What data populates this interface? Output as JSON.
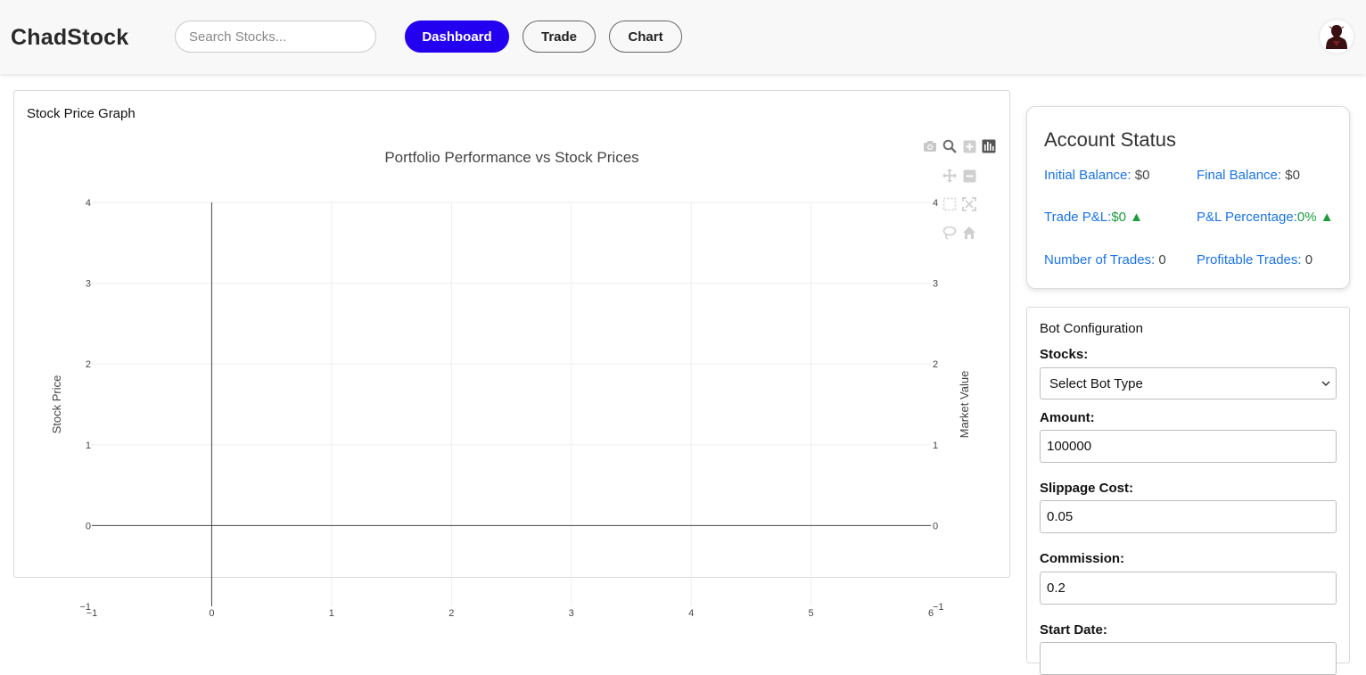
{
  "header": {
    "brand": "ChadStock",
    "search_placeholder": "Search Stocks...",
    "nav": [
      {
        "label": "Dashboard",
        "active": true
      },
      {
        "label": "Trade",
        "active": false
      },
      {
        "label": "Chart",
        "active": false
      }
    ],
    "avatar_icon": "user-avatar-icon"
  },
  "chart_card": {
    "title": "Stock Price Graph",
    "modebar_icons": [
      "camera-icon",
      "zoom-icon",
      "zoom-in-icon",
      "bar-chart-icon",
      "pan-icon",
      "zoom-out-icon",
      "box-select-icon",
      "autoscale-icon",
      "lasso-icon",
      "home-icon"
    ]
  },
  "chart_data": {
    "type": "line",
    "title": "Portfolio Performance vs Stock Prices",
    "xlabel": "",
    "ylabel": "Stock Price",
    "y2label": "Market Value",
    "xlim": [
      -1,
      6
    ],
    "ylim": [
      -1,
      4
    ],
    "y2lim": [
      -1,
      4
    ],
    "x_ticks": [
      "−1",
      "0",
      "1",
      "2",
      "3",
      "4",
      "5",
      "6"
    ],
    "y_ticks": [
      "−1",
      "0",
      "1",
      "2",
      "3",
      "4"
    ],
    "y2_ticks": [
      "−1",
      "0",
      "1",
      "2",
      "3",
      "4"
    ],
    "series": [],
    "grid": true,
    "zero_lines": true
  },
  "account": {
    "title": "Account Status",
    "initial_balance_label": "Initial Balance:",
    "initial_balance": "$0",
    "final_balance_label": "Final Balance:",
    "final_balance": "$0",
    "trade_pnl_label": "Trade P&L:",
    "trade_pnl": "$0 ▲",
    "pnl_pct_label": "P&L Percentage:",
    "pnl_pct": "0% ▲",
    "num_trades_label": "Number of Trades:",
    "num_trades": "0",
    "profitable_trades_label": "Profitable Trades:",
    "profitable_trades": "0",
    "positive_color": "#1a9e3c",
    "label_color": "#1a73e8"
  },
  "bot": {
    "title": "Bot Configuration",
    "stocks_label": "Stocks:",
    "stocks_value": "Select Bot Type",
    "amount_label": "Amount:",
    "amount_value": "100000",
    "slippage_label": "Slippage Cost:",
    "slippage_value": "0.05",
    "commission_label": "Commission:",
    "commission_value": "0.2",
    "start_date_label": "Start Date:"
  },
  "colors": {
    "accent": "#2400f0"
  }
}
